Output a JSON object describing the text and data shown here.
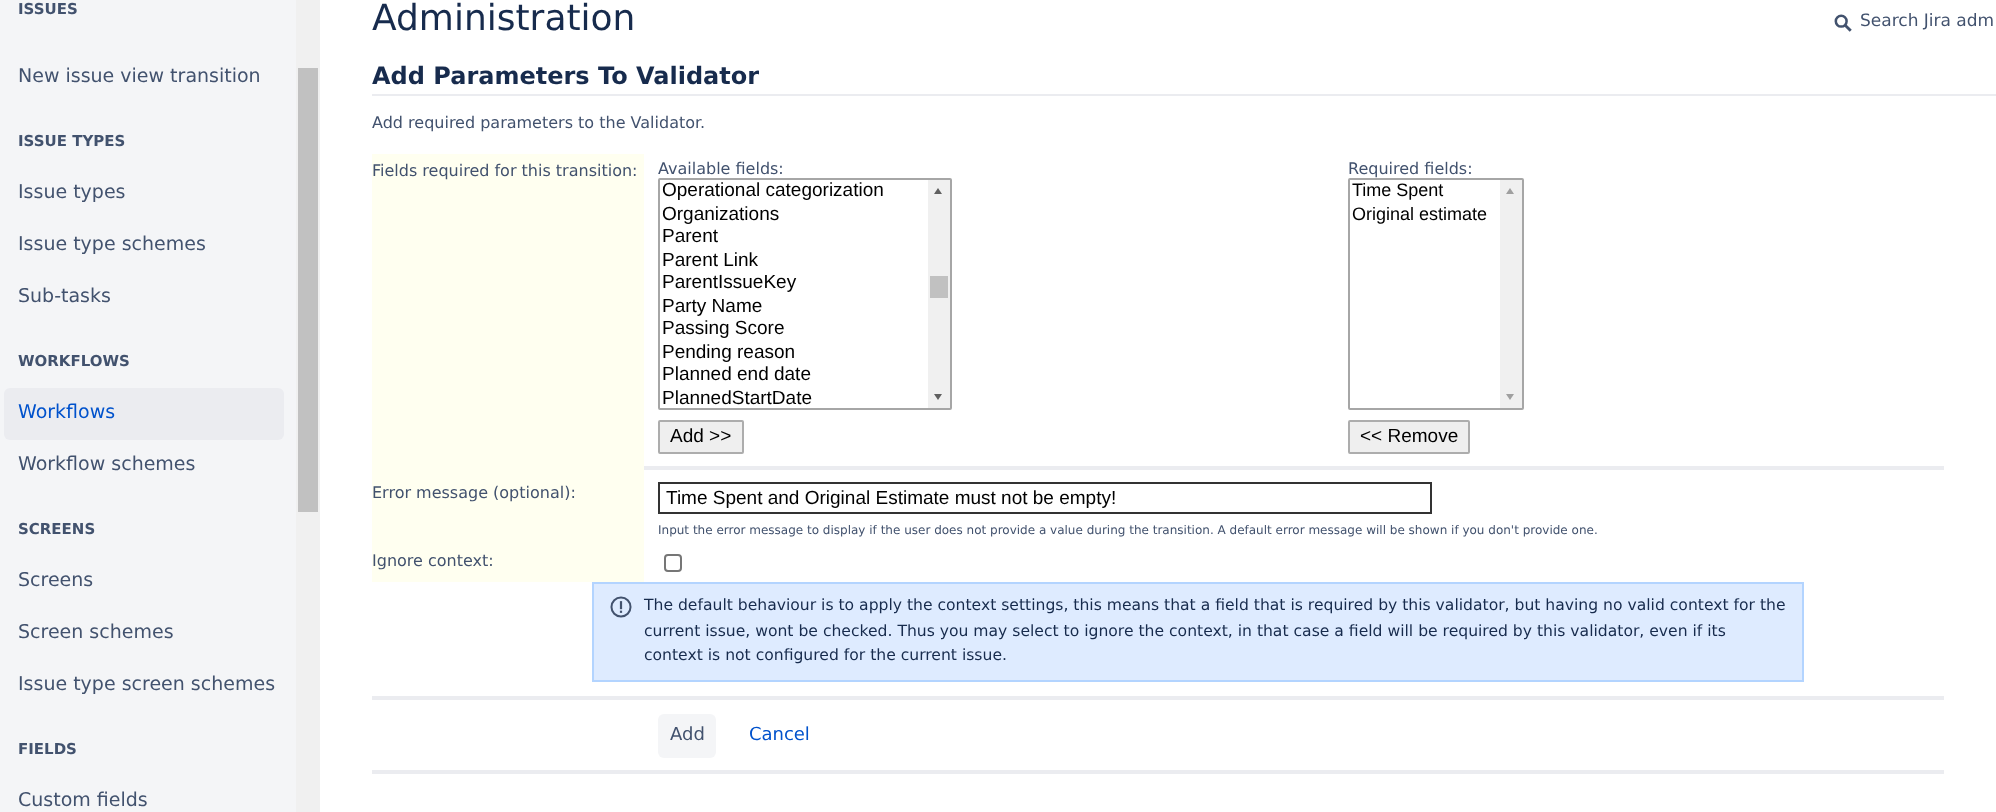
{
  "sidebar": {
    "sections": [
      {
        "heading": "ISSUES",
        "items": [
          {
            "label": "New issue view transition",
            "selected": false
          }
        ]
      },
      {
        "heading": "ISSUE TYPES",
        "items": [
          {
            "label": "Issue types",
            "selected": false
          },
          {
            "label": "Issue type schemes",
            "selected": false
          },
          {
            "label": "Sub-tasks",
            "selected": false
          }
        ]
      },
      {
        "heading": "WORKFLOWS",
        "items": [
          {
            "label": "Workflows",
            "selected": true
          },
          {
            "label": "Workflow schemes",
            "selected": false
          }
        ]
      },
      {
        "heading": "SCREENS",
        "items": [
          {
            "label": "Screens",
            "selected": false
          },
          {
            "label": "Screen schemes",
            "selected": false
          },
          {
            "label": "Issue type screen schemes",
            "selected": false
          }
        ]
      },
      {
        "heading": "FIELDS",
        "items": [
          {
            "label": "Custom fields",
            "selected": false
          }
        ]
      }
    ]
  },
  "header": {
    "title": "Administration",
    "search": {
      "placeholder": "Search Jira adm"
    }
  },
  "section": {
    "title": "Add Parameters To Validator",
    "description": "Add required parameters to the Validator."
  },
  "form": {
    "fields_label": "Fields required for this transition:",
    "available": {
      "label": "Available fields:",
      "options": [
        "Operational categorization",
        "Organizations",
        "Parent",
        "Parent Link",
        "ParentIssueKey",
        "Party Name",
        "Passing Score",
        "Pending reason",
        "Planned end date",
        "PlannedStartDate"
      ],
      "button": "Add >>"
    },
    "required": {
      "label": "Required fields:",
      "options": [
        "Time Spent",
        "Original estimate"
      ],
      "button": "<< Remove"
    },
    "error_label": "Error message (optional):",
    "error_value": "Time Spent and Original Estimate must not be empty!",
    "error_help": "Input the error message to display if the user does not provide a value during the transition. A default error message will be shown if you don't provide one.",
    "ignore_label": "Ignore context:",
    "ignore_checked": false,
    "info": "The default behaviour is to apply the context settings, this means that a field that is required by this validator, but having no valid context for the current issue, wont be checked. Thus you may select to ignore the context, in that case a field will be required by this validator, even if its context is not configured for the current issue.",
    "buttons": {
      "submit": "Add",
      "cancel": "Cancel"
    }
  }
}
